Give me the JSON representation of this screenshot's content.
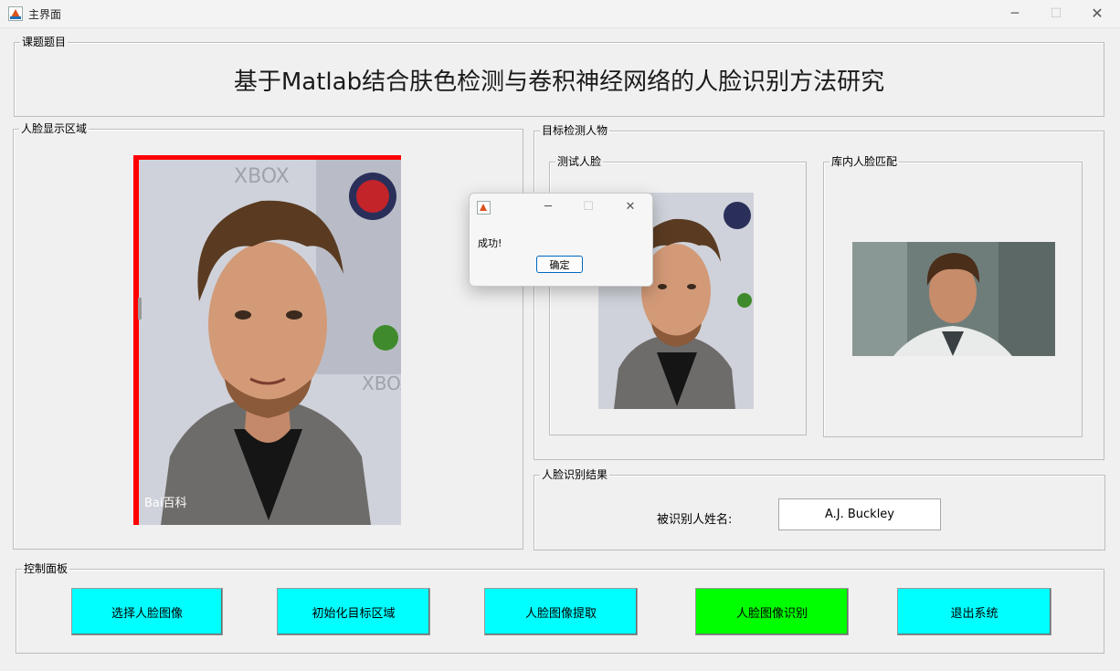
{
  "window": {
    "title": "主界面",
    "minimize_glyph": "─",
    "maximize_glyph": "☐",
    "close_glyph": "✕"
  },
  "topic_panel": {
    "legend": "课题题目",
    "heading": "基于Matlab结合肤色检测与卷积神经网络的人脸识别方法研究"
  },
  "display_panel": {
    "legend": "人脸显示区域"
  },
  "target_panel": {
    "legend": "目标检测人物",
    "test_face": {
      "legend": "测试人脸"
    },
    "db_face": {
      "legend": "库内人脸匹配"
    }
  },
  "photo_watermark": {
    "baidu": "Bai百科",
    "xbox": "XBOX"
  },
  "result_panel": {
    "legend": "人脸识别结果",
    "name_label": "被识别人姓名:",
    "name_value": "A.J. Buckley"
  },
  "control_panel": {
    "legend": "控制面板",
    "buttons": [
      {
        "label": "选择人脸图像",
        "color": "#00ffff"
      },
      {
        "label": "初始化目标区域",
        "color": "#00ffff"
      },
      {
        "label": "人脸图像提取",
        "color": "#00ffff"
      },
      {
        "label": "人脸图像识别",
        "color": "#00ff00"
      },
      {
        "label": "退出系统",
        "color": "#00ffff"
      }
    ]
  },
  "dialog": {
    "message": "成功!",
    "ok_label": "确定",
    "minimize_glyph": "─",
    "maximize_glyph": "☐",
    "close_glyph": "✕"
  },
  "colors": {
    "selection_border": "#ff0000",
    "accent": "#0067c0"
  }
}
